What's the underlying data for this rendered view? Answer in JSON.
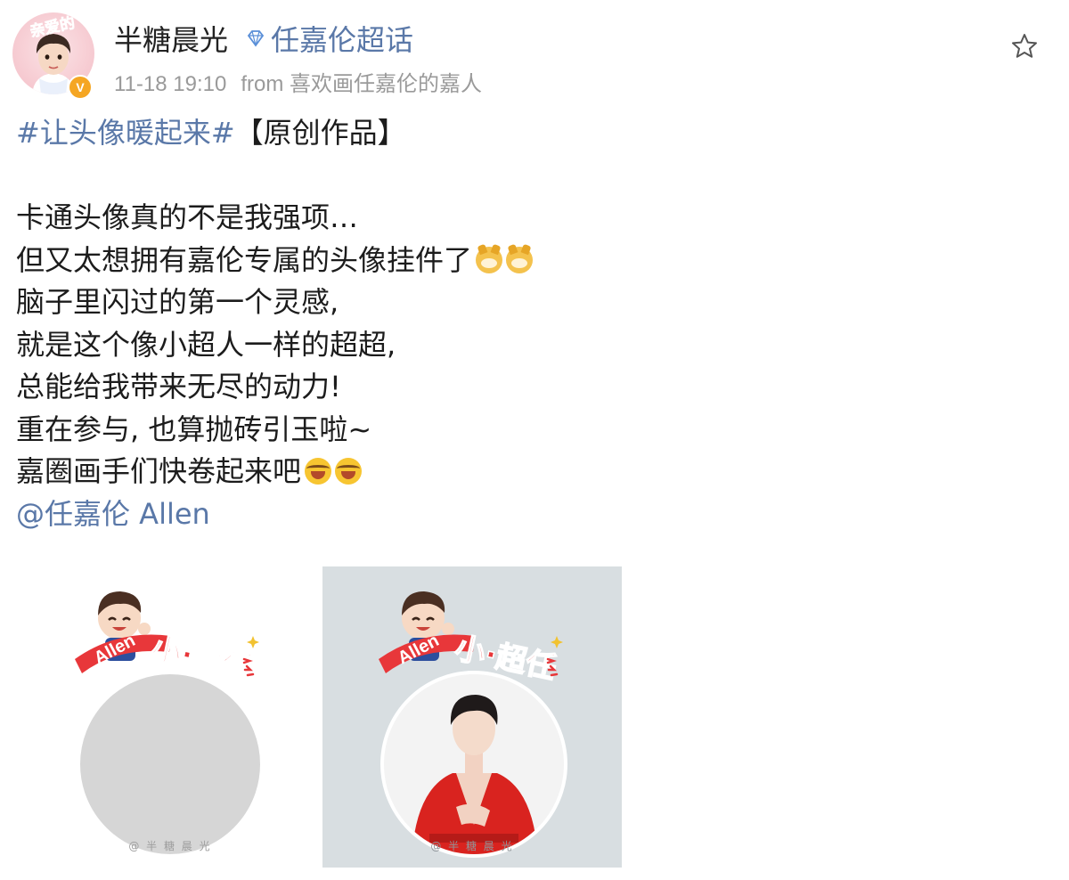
{
  "post": {
    "author": {
      "name": "半糖晨光",
      "avatar_badge_text": "亲爱的",
      "verified_mark": "V"
    },
    "supertopic": "任嘉伦超话",
    "time": "11-18 19:10",
    "source": "from 喜欢画任嘉伦的嘉人",
    "icons": [
      "avatar",
      "verified-badge-icon",
      "diamond-icon",
      "star-icon"
    ]
  },
  "content": {
    "hashtag": "#让头像暖起来#",
    "tag_suffix": "【原创作品】",
    "lines": [
      "卡通头像真的不是我强项…",
      "但又太想拥有嘉伦专属的头像挂件了",
      "脑子里闪过的第一个灵感,",
      "就是这个像小超人一样的超超,",
      "总能给我带来无尽的动力!",
      "重在参与, 也算抛砖引玉啦~",
      "嘉圈画手们快卷起来吧"
    ],
    "mention": "@任嘉伦 Allen"
  },
  "images": [
    {
      "banner_text": "小·超任",
      "name_text": "Allen",
      "watermark": "@ 半 糖 晨 光"
    },
    {
      "banner_text": "小·超任",
      "name_text": "Allen",
      "watermark": "@ 半 糖 晨 光"
    }
  ],
  "colors": {
    "link": "#5a78a8",
    "banner_red": "#e8373a",
    "verified": "#f5a623",
    "meta_gray": "#9a9a9a",
    "suit_red": "#d9231f"
  }
}
